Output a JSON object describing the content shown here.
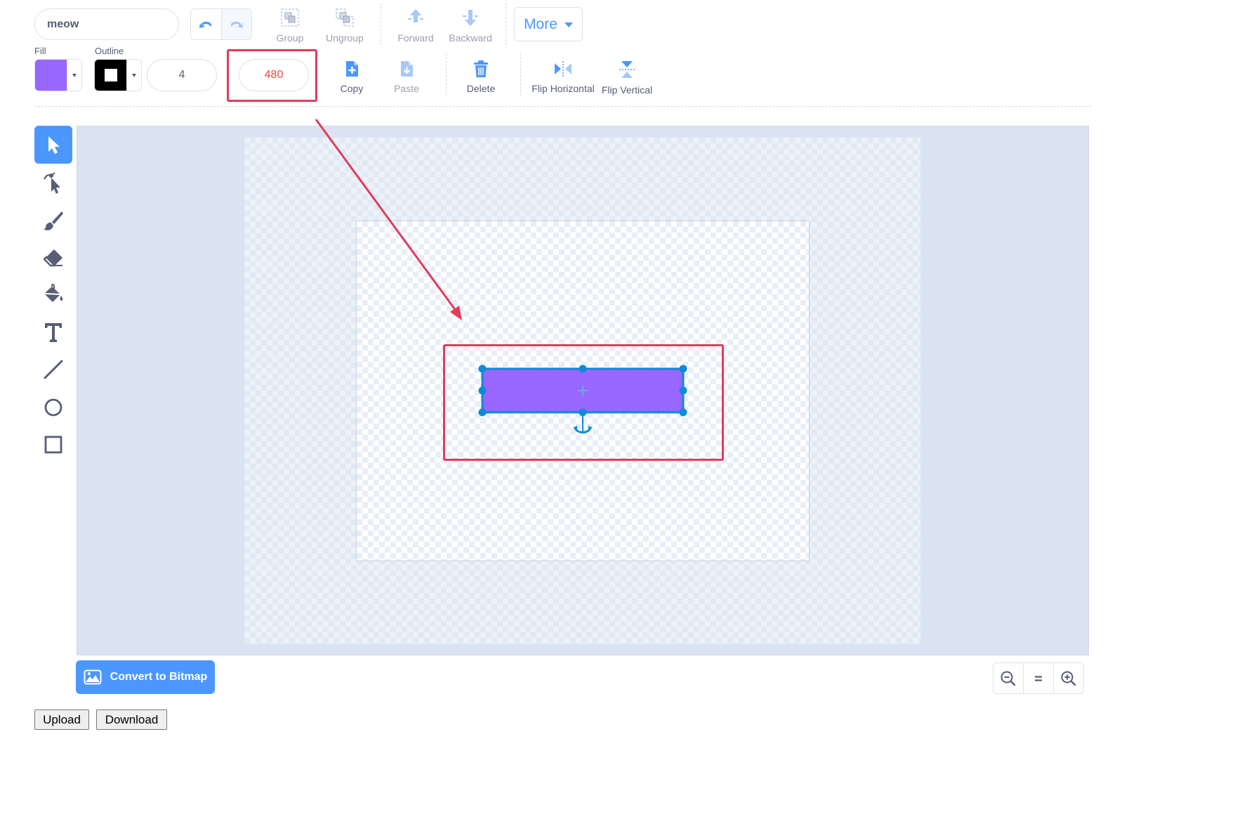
{
  "costume": {
    "name": "meow"
  },
  "toolbar": {
    "group_label": "Group",
    "ungroup_label": "Ungroup",
    "forward_label": "Forward",
    "backward_label": "Backward",
    "more_label": "More",
    "fill_label": "Fill",
    "outline_label": "Outline",
    "outline_width": "4",
    "size_value": "480",
    "copy_label": "Copy",
    "paste_label": "Paste",
    "delete_label": "Delete",
    "flip_horizontal_label": "Flip Horizontal",
    "flip_vertical_label": "Flip Vertical"
  },
  "colors": {
    "fill": "#9966ff",
    "outline": "#000000",
    "accent": "#4c97ff",
    "selection": "#0b8bd8",
    "highlight": "#e23c5c"
  },
  "tools": [
    {
      "name": "select",
      "icon": "arrow-pointer-icon",
      "active": true
    },
    {
      "name": "reshape",
      "icon": "reshape-pointer-icon",
      "active": false
    },
    {
      "name": "brush",
      "icon": "brush-icon",
      "active": false
    },
    {
      "name": "eraser",
      "icon": "eraser-icon",
      "active": false
    },
    {
      "name": "fill",
      "icon": "paint-bucket-icon",
      "active": false
    },
    {
      "name": "text",
      "icon": "text-t-icon",
      "active": false
    },
    {
      "name": "line",
      "icon": "line-icon",
      "active": false
    },
    {
      "name": "circle",
      "icon": "circle-icon",
      "active": false
    },
    {
      "name": "rectangle",
      "icon": "rectangle-icon",
      "active": false
    }
  ],
  "footer": {
    "convert_label": "Convert to Bitmap",
    "upload_label": "Upload",
    "download_label": "Download"
  }
}
